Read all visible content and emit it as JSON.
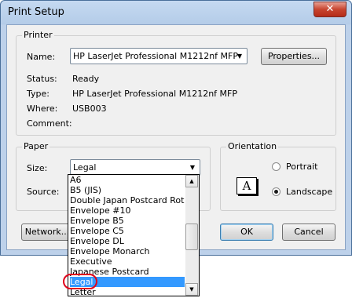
{
  "window": {
    "title": "Print Setup",
    "close_glyph": "✕"
  },
  "printer": {
    "group_label": "Printer",
    "name_label": "Name:",
    "name_value": "HP LaserJet Professional M1212nf MFP",
    "properties_label": "Properties...",
    "status_label": "Status:",
    "status_value": "Ready",
    "type_label": "Type:",
    "type_value": "HP LaserJet Professional M1212nf MFP",
    "where_label": "Where:",
    "where_value": "USB003",
    "comment_label": "Comment:"
  },
  "paper": {
    "group_label": "Paper",
    "size_label": "Size:",
    "size_value": "Legal",
    "source_label": "Source:",
    "options": [
      "A6",
      "B5 (JIS)",
      "Double Japan Postcard Rotated",
      "Envelope #10",
      "Envelope B5",
      "Envelope C5",
      "Envelope DL",
      "Envelope Monarch",
      "Executive",
      "Japanese Postcard",
      "Legal",
      "Letter"
    ],
    "selected_option": "Legal"
  },
  "orientation": {
    "group_label": "Orientation",
    "portrait_label": "Portrait",
    "landscape_label": "Landscape",
    "selected": "Landscape",
    "icon_letter": "A"
  },
  "buttons": {
    "network": "Network...",
    "ok": "OK",
    "cancel": "Cancel"
  },
  "colors": {
    "selection": "#3399ff",
    "highlight_ring": "#e0001a",
    "title_bar": "#c5d9f1"
  }
}
